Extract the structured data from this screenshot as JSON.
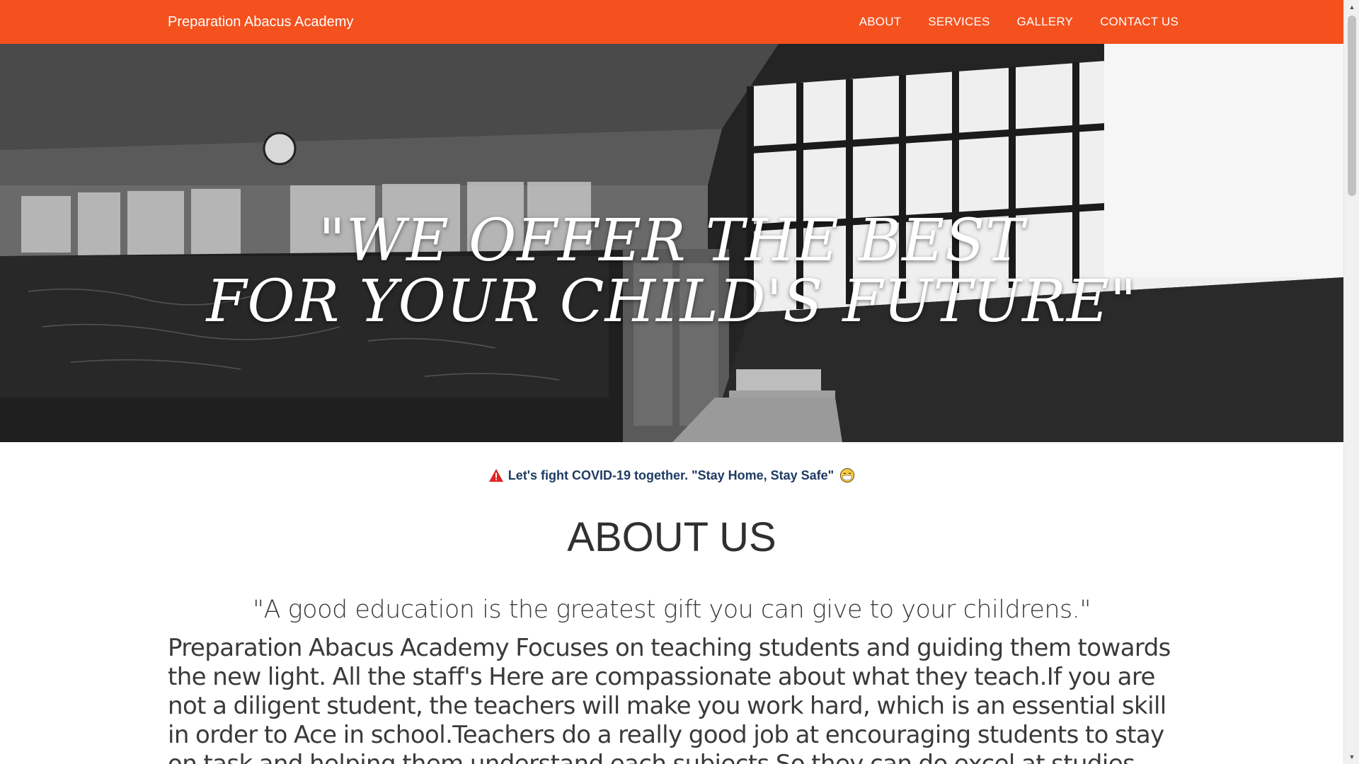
{
  "navbar": {
    "brand": "Preparation Abacus Academy",
    "links": [
      {
        "label": "ABOUT"
      },
      {
        "label": "SERVICES"
      },
      {
        "label": "GALLERY"
      },
      {
        "label": "CONTACT US"
      }
    ],
    "bg_color": "#f4511e"
  },
  "hero": {
    "line1": "\"WE OFFER THE BEST",
    "line2": "FOR YOUR CHILD'S FUTURE\""
  },
  "notice": {
    "text": "Let's fight COVID-19 together. \"Stay Home, Stay Safe\"",
    "leading_icon": "warning-icon",
    "trailing_icon": "face-mask-icon",
    "text_color": "#1f3b63"
  },
  "about": {
    "heading": "ABOUT US",
    "quote": "\"A good education is the greatest gift you can give to your childrens.\"",
    "body": "Preparation Abacus Academy Focuses on teaching students and guiding them towards the new light. All the staff's Here are compassionate about what they teach.If you are not a diligent student, the teachers will make you work hard, which is an essential skill in order to Ace in school.Teachers do a really good job at encouraging students to stay on task and helping them understand each subjects So they can do excel at studies."
  }
}
